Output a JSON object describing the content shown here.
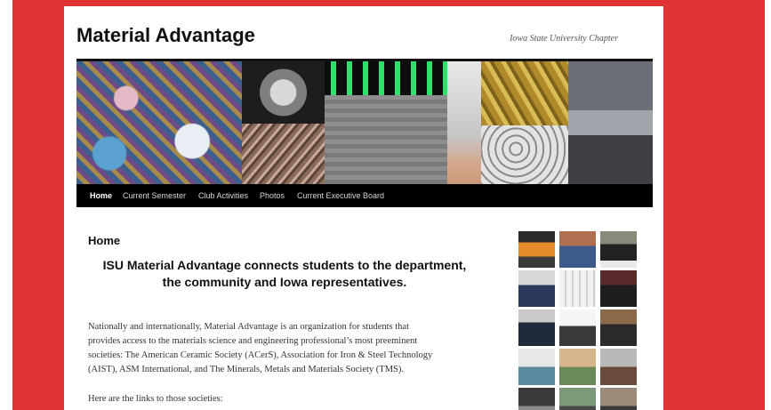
{
  "site": {
    "title": "Material Advantage",
    "tagline": "Iowa State University Chapter"
  },
  "nav": {
    "items": [
      {
        "label": "Home",
        "active": true
      },
      {
        "label": "Current Semester",
        "active": false
      },
      {
        "label": "Club Activities",
        "active": false
      },
      {
        "label": "Photos",
        "active": false
      },
      {
        "label": "Current Executive Board",
        "active": false
      }
    ]
  },
  "main": {
    "heading": "Home",
    "tagline_line1": "ISU Material Advantage connects students to the department,",
    "tagline_line2": "the community and Iowa representatives.",
    "paragraph_lines": [
      "Nationally and internationally, Material Advantage is an organization for students that",
      "provides access to the materials science and engineering professional’s most preeminent",
      "societies: The American Ceramic Society (ACerS), Association for Iron & Steel Technology",
      "(AIST), ASM International, and The Minerals, Metals and Materials Society (TMS)."
    ],
    "links_intro": "Here are the links to those societies:"
  },
  "colors": {
    "page_border": "#e03333",
    "nav_background": "#000000",
    "nav_text": "#d6d6d6"
  }
}
